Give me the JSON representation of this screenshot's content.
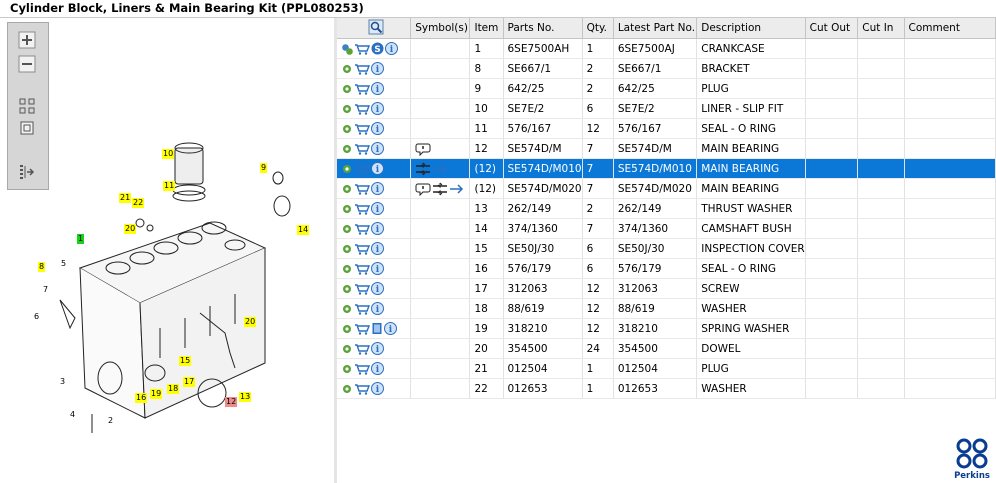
{
  "title": "Cylinder Block, Liners & Main Bearing Kit (PPL080253)",
  "toolbox": [
    "zoom-in-icon",
    "zoom-out-icon",
    "fit-view-icon",
    "actual-size-icon",
    "list-view-icon"
  ],
  "callouts": {
    "c1": "1",
    "c2": "2",
    "c3": "3",
    "c4": "4",
    "c5": "5",
    "c6": "6",
    "c7": "7",
    "c8": "8",
    "c9": "9",
    "c10": "10",
    "c11": "11",
    "c12": "12",
    "c13": "13",
    "c14": "14",
    "c15": "15",
    "c16": "16",
    "c17": "17",
    "c18": "18",
    "c19": "19",
    "c20a": "20",
    "c20b": "20",
    "c21": "21",
    "c22": "22"
  },
  "columns": [
    "",
    "Symbol(s)",
    "Item",
    "Parts No.",
    "Qty.",
    "Latest Part No.",
    "Description",
    "Cut Out",
    "Cut In",
    "Comment"
  ],
  "rows": [
    {
      "item": "1",
      "part": "6SE7500AH",
      "qty": "1",
      "latest": "6SE7500AJ",
      "desc": "CRANKCASE",
      "icons": "gear-cart-s-info",
      "sym": ""
    },
    {
      "item": "8",
      "part": "SE667/1",
      "qty": "2",
      "latest": "SE667/1",
      "desc": "BRACKET",
      "icons": "std",
      "sym": ""
    },
    {
      "item": "9",
      "part": "642/25",
      "qty": "2",
      "latest": "642/25",
      "desc": "PLUG",
      "icons": "std",
      "sym": ""
    },
    {
      "item": "10",
      "part": "SE7E/2",
      "qty": "6",
      "latest": "SE7E/2",
      "desc": "LINER - SLIP FIT",
      "icons": "std",
      "sym": ""
    },
    {
      "item": "11",
      "part": "576/167",
      "qty": "12",
      "latest": "576/167",
      "desc": "SEAL - O RING",
      "icons": "std",
      "sym": ""
    },
    {
      "item": "12",
      "part": "SE574D/M",
      "qty": "7",
      "latest": "SE574D/M",
      "desc": "MAIN BEARING",
      "icons": "std",
      "sym": "note"
    },
    {
      "item": "(12)",
      "part": "SE574D/M010",
      "qty": "7",
      "latest": "SE574D/M010",
      "desc": "MAIN BEARING",
      "icons": "std",
      "sym": "size",
      "selected": true
    },
    {
      "item": "(12)",
      "part": "SE574D/M020",
      "qty": "7",
      "latest": "SE574D/M020",
      "desc": "MAIN BEARING",
      "icons": "std",
      "sym": "note-size"
    },
    {
      "item": "13",
      "part": "262/149",
      "qty": "2",
      "latest": "262/149",
      "desc": "THRUST WASHER",
      "icons": "std",
      "sym": ""
    },
    {
      "item": "14",
      "part": "374/1360",
      "qty": "7",
      "latest": "374/1360",
      "desc": "CAMSHAFT BUSH",
      "icons": "std",
      "sym": ""
    },
    {
      "item": "15",
      "part": "SE50J/30",
      "qty": "6",
      "latest": "SE50J/30",
      "desc": "INSPECTION COVER",
      "icons": "std",
      "sym": ""
    },
    {
      "item": "16",
      "part": "576/179",
      "qty": "6",
      "latest": "576/179",
      "desc": "SEAL - O RING",
      "icons": "std",
      "sym": ""
    },
    {
      "item": "17",
      "part": "312063",
      "qty": "12",
      "latest": "312063",
      "desc": "SCREW",
      "icons": "std",
      "sym": ""
    },
    {
      "item": "18",
      "part": "88/619",
      "qty": "12",
      "latest": "88/619",
      "desc": "WASHER",
      "icons": "std",
      "sym": ""
    },
    {
      "item": "19",
      "part": "318210",
      "qty": "12",
      "latest": "318210",
      "desc": "SPRING WASHER",
      "icons": "gear-cart-book-info",
      "sym": ""
    },
    {
      "item": "20",
      "part": "354500",
      "qty": "24",
      "latest": "354500",
      "desc": "DOWEL",
      "icons": "std",
      "sym": ""
    },
    {
      "item": "21",
      "part": "012504",
      "qty": "1",
      "latest": "012504",
      "desc": "PLUG",
      "icons": "std",
      "sym": ""
    },
    {
      "item": "22",
      "part": "012653",
      "qty": "1",
      "latest": "012653",
      "desc": "WASHER",
      "icons": "std",
      "sym": ""
    }
  ],
  "logo": {
    "text": "Perkins",
    "color": "#0a3d91"
  },
  "colors": {
    "selection": "#0b78d7",
    "callout": "#ffff00",
    "callout_highlight": "#19d119",
    "callout_marked": "#ee8b8b"
  }
}
